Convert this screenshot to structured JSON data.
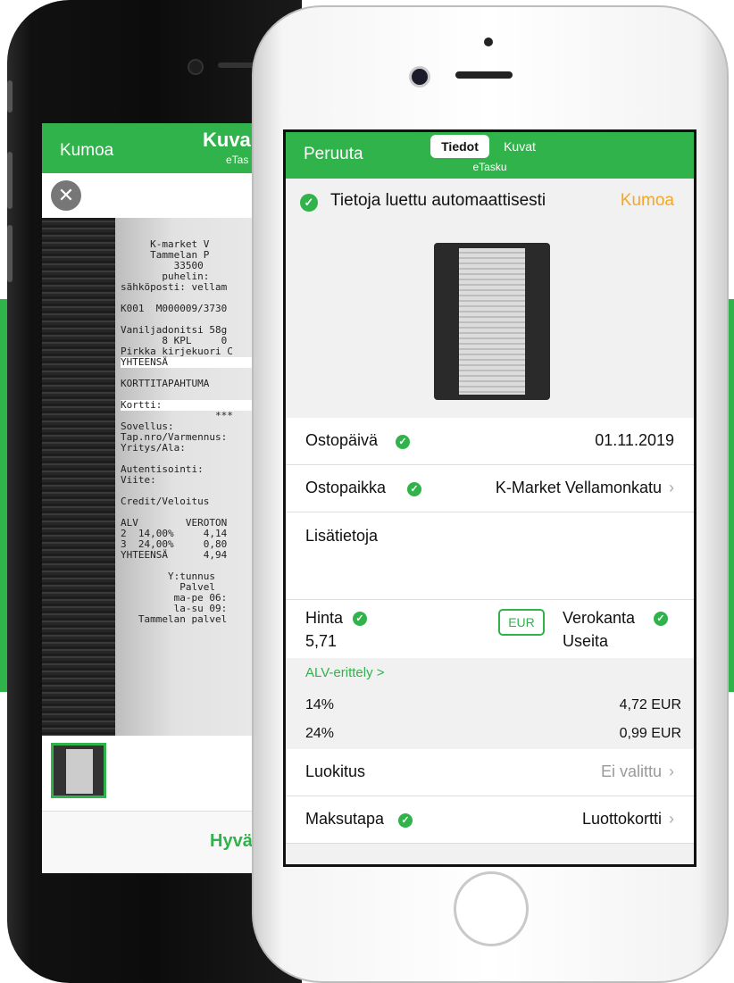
{
  "back_screen": {
    "nav_cancel": "Kumoa",
    "nav_title": "Kuva",
    "nav_subtitle": "eTas",
    "receipt_lines": [
      "     K-market V",
      "     Tammelan P",
      "         33500",
      "       puhelin:",
      "sähköposti: vellam",
      "",
      "K001  M000009/3730",
      "",
      "Vaniljadonitsi 58g",
      "       8 KPL     0",
      "Pirkka kirjekuori C",
      "YHTEENSÄ",
      "",
      "KORTTITAPAHTUMA",
      "",
      "Kortti:",
      "                ***",
      "Sovellus:",
      "Tap.nro/Varmennus:",
      "Yritys/Ala:",
      "",
      "Autentisointi:",
      "Viite:",
      "",
      "Credit/Veloitus",
      "",
      "ALV        VEROTON",
      "2  14,00%     4,14",
      "3  24,00%     0,80",
      "YHTEENSÄ      4,94",
      "",
      "        Y:tunnus",
      "          Palvel",
      "         ma-pe 06:",
      "         la-su 09:",
      "   Tammelan palvel"
    ],
    "approve_label": "Hyvä"
  },
  "front_screen": {
    "nav_cancel": "Peruuta",
    "tab_active": "Tiedot",
    "tab_inactive": "Kuvat",
    "nav_subtitle": "eTasku",
    "notice_text": "Tietoja luettu automaattisesti",
    "notice_undo": "Kumoa",
    "purchase_date_label": "Ostopäivä",
    "purchase_date_value": "01.11.2019",
    "purchase_place_label": "Ostopaikka",
    "purchase_place_value": "K-Market Vellamonkatu",
    "extra_info_label": "Lisätietoja",
    "price_label": "Hinta",
    "price_value": "5,71",
    "currency": "EUR",
    "tax_rate_label": "Verokanta",
    "tax_rate_value": "Useita",
    "vat_breakdown_link": "ALV-erittely >",
    "vat_rows": [
      {
        "rate": "14%",
        "amount": "4,72 EUR"
      },
      {
        "rate": "24%",
        "amount": "0,99 EUR"
      }
    ],
    "classification_label": "Luokitus",
    "classification_value": "Ei valittu",
    "payment_method_label": "Maksutapa",
    "payment_method_value": "Luottokortti"
  },
  "colors": {
    "brand_green": "#2fb34a",
    "undo_orange": "#f5a623"
  },
  "icons": {
    "check": "✓",
    "chevron": "›",
    "close": "✕"
  }
}
